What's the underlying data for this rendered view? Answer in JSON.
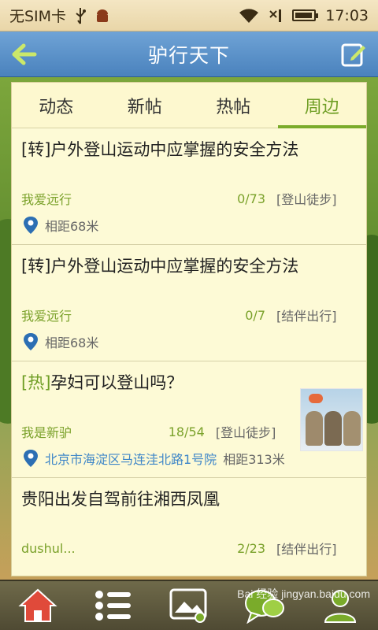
{
  "status_bar": {
    "carrier": "无SIM卡",
    "time": "17:03",
    "icons": [
      "usb-icon",
      "android-debug-icon",
      "wifi-icon",
      "no-signal-icon",
      "battery-icon"
    ]
  },
  "header": {
    "title": "驴行天下",
    "back_icon": "back-arrow-icon",
    "edit_icon": "compose-icon"
  },
  "tabs": [
    {
      "label": "动态",
      "active": false
    },
    {
      "label": "新帖",
      "active": false
    },
    {
      "label": "热帖",
      "active": false
    },
    {
      "label": "周边",
      "active": true
    }
  ],
  "posts": [
    {
      "tag": "[转]",
      "title": "户外登山运动中应掌握的安全方法",
      "author": "我爱远行",
      "counts": "0/73",
      "category": "[登山徒步]",
      "address": "",
      "distance": "相距68米",
      "has_image": false
    },
    {
      "tag": "[转]",
      "title": "户外登山运动中应掌握的安全方法",
      "author": "我爱远行",
      "counts": "0/7",
      "category": "[结伴出行]",
      "address": "",
      "distance": "相距68米",
      "has_image": false
    },
    {
      "tag": "[热]",
      "title": "孕妇可以登山吗？",
      "author": "我是新驴",
      "counts": "18/54",
      "category": "[登山徒步]",
      "address": "北京市海淀区马连洼北路1号院",
      "distance": "相距313米",
      "has_image": true
    },
    {
      "tag": "",
      "title": "贵阳出发自驾前往湘西凤凰",
      "author": "dushul...",
      "counts": "2/23",
      "category": "[结伴出行]",
      "address": "",
      "distance": "",
      "has_image": false
    }
  ],
  "bottom_bar": [
    "home-icon",
    "list-icon",
    "photo-icon",
    "chat-icon",
    "user-icon"
  ],
  "watermark": "Bai 经验  jingyan.baidu.com",
  "colors": {
    "accent": "#7aab2a",
    "header": "#4a82bd",
    "panel": "#fdfad6"
  }
}
